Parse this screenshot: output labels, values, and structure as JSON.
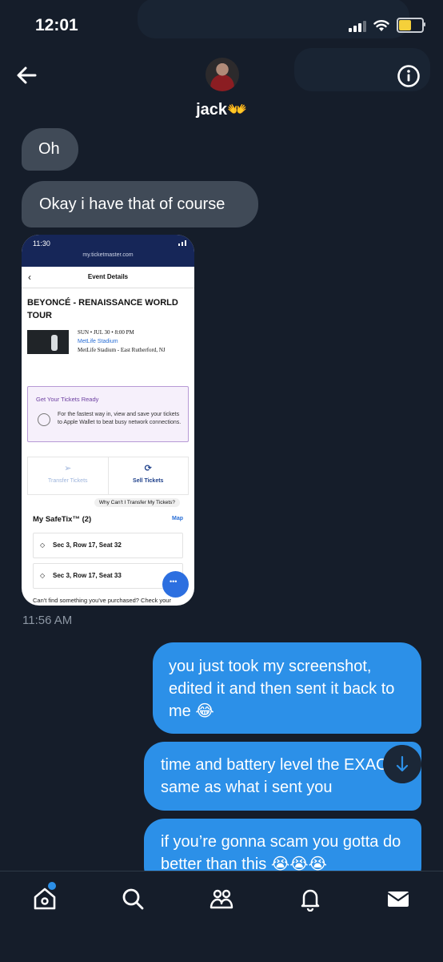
{
  "status_bar": {
    "time": "12:01"
  },
  "header": {
    "contact_name": "jack👐"
  },
  "messages": [
    {
      "direction": "incoming",
      "text": "Oh"
    },
    {
      "direction": "incoming",
      "text": "Okay i have that of course"
    },
    {
      "direction": "incoming",
      "type": "image",
      "timestamp": "11:56 AM"
    },
    {
      "direction": "outgoing",
      "text": "you just took my screenshot, edited it and then sent it back to me 😂"
    },
    {
      "direction": "outgoing",
      "text": "time and battery level the EXACT same as what i sent you"
    },
    {
      "direction": "outgoing",
      "text": "if you’re gonna scam you gotta do better than this 😭😭😭"
    }
  ],
  "screenshot": {
    "time": "11:30",
    "url": "my.ticketmaster.com",
    "nav_title": "Event Details",
    "event_title": "BEYONCÉ - RENAISSANCE WORLD TOUR",
    "date_line": "SUN • JUL 30 • 8:00 PM",
    "venue_link": "MetLife Stadium",
    "venue_line": "MetLife Stadium - East Rutherford, NJ",
    "ready_heading": "Get Your Tickets Ready",
    "ready_body": "For the fastest way in, view and save your tickets to Apple Wallet to beat busy network connections.",
    "transfer_label": "Transfer Tickets",
    "sell_label": "Sell Tickets",
    "why_label": "Why Can't I Transfer My Tickets?",
    "safetix_label": "My SafeTix™ (2)",
    "map_label": "Map",
    "seats": [
      "Sec 3, Row 17, Seat 32",
      "Sec 3, Row 17, Seat 33"
    ],
    "footer": "Can't find something you've purchased? Check your"
  },
  "nav": {
    "items": [
      "home-icon",
      "search-icon",
      "communities-icon",
      "notifications-icon",
      "messages-icon"
    ]
  },
  "colors": {
    "outgoing": "#2c90e8",
    "incoming": "#404a57",
    "background": "#151d2a"
  }
}
